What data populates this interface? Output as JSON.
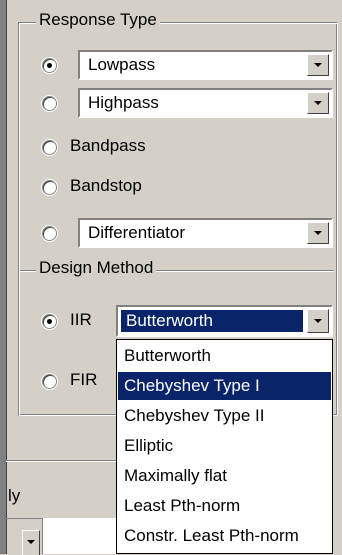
{
  "response_type": {
    "title": "Response Type",
    "options": [
      {
        "kind": "combo",
        "value": "Lowpass",
        "selected": true
      },
      {
        "kind": "combo",
        "value": "Highpass",
        "selected": false
      },
      {
        "kind": "radio",
        "label": "Bandpass",
        "selected": false
      },
      {
        "kind": "radio",
        "label": "Bandstop",
        "selected": false
      },
      {
        "kind": "combo",
        "value": "Differentiator",
        "selected": false
      }
    ]
  },
  "design_method": {
    "title": "Design Method",
    "iir": {
      "label": "IIR",
      "selected": true,
      "value": "Butterworth"
    },
    "fir": {
      "label": "FIR",
      "selected": false
    }
  },
  "dropdown": {
    "options": [
      "Butterworth",
      "Chebyshev Type I",
      "Chebyshev Type II",
      "Elliptic",
      "Maximally flat",
      "Least Pth-norm",
      "Constr. Least Pth-norm"
    ],
    "highlighted_index": 1
  },
  "partial_label": "ly",
  "colors": {
    "selection": "#0a246a",
    "face": "#d4d0c8"
  }
}
